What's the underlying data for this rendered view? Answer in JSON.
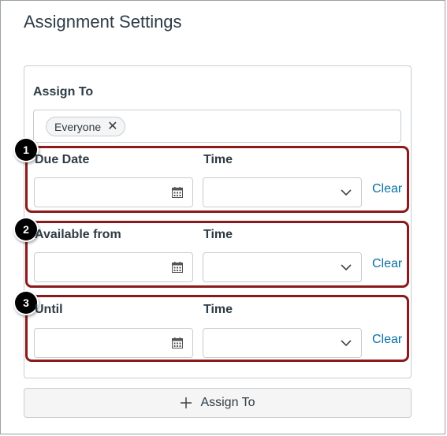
{
  "page": {
    "title": "Assignment Settings"
  },
  "assign": {
    "label": "Assign To",
    "tags": [
      {
        "label": "Everyone"
      }
    ]
  },
  "groups": [
    {
      "badge": "1",
      "date_label": "Due Date",
      "time_label": "Time",
      "clear_label": "Clear"
    },
    {
      "badge": "2",
      "date_label": "Available from",
      "time_label": "Time",
      "clear_label": "Clear"
    },
    {
      "badge": "3",
      "date_label": "Until",
      "time_label": "Time",
      "clear_label": "Clear"
    }
  ],
  "add_button": {
    "label": "Assign To"
  },
  "colors": {
    "highlight_border": "#8b1a1a",
    "link": "#0770a3",
    "text": "#2d3b45"
  },
  "icons": {
    "tag_remove": "close-icon",
    "date": "calendar-icon",
    "time": "chevron-down-icon",
    "add": "plus-icon"
  }
}
